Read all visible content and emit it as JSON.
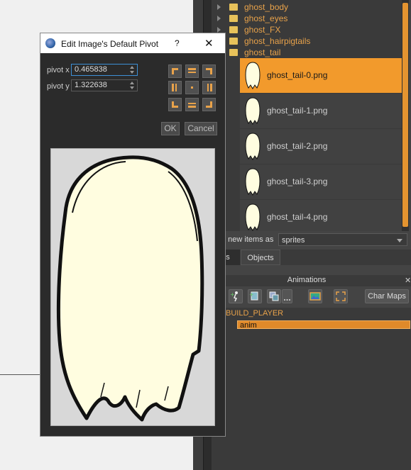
{
  "tree": {
    "folders": [
      {
        "label": "ghost_body"
      },
      {
        "label": "ghost_eyes"
      },
      {
        "label": "ghost_FX"
      },
      {
        "label": "ghost_hairpigtails"
      },
      {
        "label": "ghost_tail"
      }
    ],
    "images": [
      {
        "label": "ghost_tail-0.png",
        "selected": true
      },
      {
        "label": "ghost_tail-1.png"
      },
      {
        "label": "ghost_tail-2.png"
      },
      {
        "label": "ghost_tail-3.png"
      },
      {
        "label": "ghost_tail-4.png"
      }
    ]
  },
  "add_items": {
    "label": "g new items as",
    "value": "sprites"
  },
  "tabs": {
    "images": "es",
    "objects": "Objects"
  },
  "animations": {
    "title": "Animations",
    "close": "✕",
    "char_maps_label": "Char Maps",
    "build_label": "BUILD_PLAYER",
    "anim_label": "anim"
  },
  "dialog": {
    "title": "Edit Image's Default Pivot",
    "help": "?",
    "close": "✕",
    "pivot_x_label": "pivot x",
    "pivot_x_value": "0.465838",
    "pivot_y_label": "pivot y",
    "pivot_y_value": "1.322638",
    "ok_label": "OK",
    "cancel_label": "Cancel"
  },
  "colors": {
    "accent": "#f29a2c",
    "folder_text": "#e8a24a",
    "ghost_fill": "#fffde0",
    "outline": "#111111"
  }
}
